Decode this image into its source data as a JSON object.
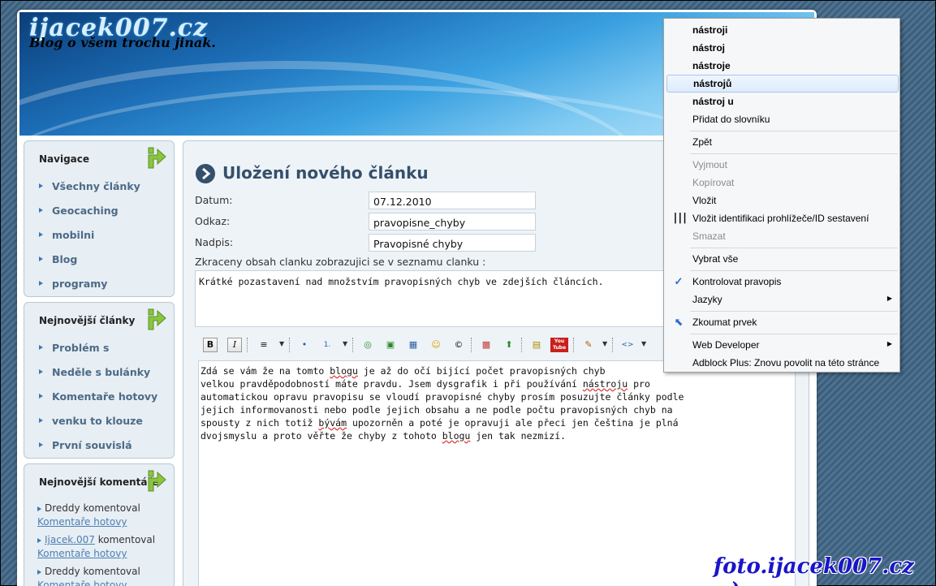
{
  "header": {
    "site_title": "ijacek007.cz",
    "subtitle": "Blog o všem trochu jinak."
  },
  "sidebar": {
    "navigation": {
      "title": "Navigace",
      "items": [
        "Všechny články",
        "Geocaching",
        "mobilni",
        "Blog",
        "programy"
      ]
    },
    "latest_articles": {
      "title": "Nejnovější články",
      "items": [
        "Problém s",
        "Neděle s bulánky",
        "Komentaře hotovy",
        "venku to klouze",
        "První souvislá"
      ]
    },
    "latest_comments": {
      "title": "Nejnovější komentáře",
      "items": [
        {
          "author": "Dreddy",
          "verb": "komentoval",
          "link": "Komentaře hotovy"
        },
        {
          "author": "Ijacek.007",
          "verb": "komentoval",
          "link": "Komentaře hotovy"
        },
        {
          "author": "Dreddy",
          "verb": "komentoval",
          "link": "Komentaře hotovy"
        }
      ]
    }
  },
  "content": {
    "title": "Uložení nového článku",
    "form": {
      "date_label": "Datum:",
      "date_value": "07.12.2010",
      "link_label": "Odkaz:",
      "link_value": "pravopisne_chyby",
      "heading_label": "Nadpis:",
      "heading_value": "Pravopisné chyby",
      "summary_label": "Zkraceny obsah clanku zobrazujici se v seznamu clanku :",
      "summary_value": "Krátké pozastavení nad množstvím pravopisných chyb ve zdejších článcích."
    },
    "editor": {
      "lines": [
        "Zdá se vám že na tomto ",
        "blogu",
        " je až do očí bijící počet pravopisných chyb",
        "velkou pravděpodobností máte pravdu. Jsem dysgrafik i při používání ",
        "nástroju",
        " pro",
        "automatickou opravu pravopisu se vloudí pravopisné chyby prosím posuzujte články podle",
        "jejich informovanosti nebo podle jejich obsahu a ne podle počtu pravopisných chyb na",
        "spousty z nich totiž ",
        "bývám",
        " upozorněn a poté je opravuji ale přeci jen čeština je plná",
        "dvojsmyslu a proto věřte že chyby z tohoto ",
        "blogu",
        " jen tak nezmizí."
      ]
    },
    "toolbar_buttons": [
      "B",
      "I",
      "≡",
      "•",
      "1.",
      "◎",
      "▣",
      "▦",
      "☺",
      "©",
      "▩",
      "⬆",
      "▤",
      "You Tube",
      "✎",
      "<>"
    ]
  },
  "context_menu": {
    "suggestions": [
      "nástroji",
      "nástroj",
      "nástroje",
      "nástrojů",
      "nástroj u"
    ],
    "add_to_dictionary": "Přidat do slovníku",
    "undo": "Zpět",
    "cut": "Vyjmout",
    "copy": "Kopírovat",
    "paste": "Vložit",
    "paste_ua": "Vložit identifikaci prohlížeče/ID sestavení",
    "delete": "Smazat",
    "select_all": "Vybrat vše",
    "spellcheck": "Kontrolovat pravopis",
    "languages": "Jazyky",
    "inspect": "Zkoumat prvek",
    "web_developer": "Web Developer",
    "adblock": "Adblock Plus: Znovu povolit na této stránce"
  },
  "watermark": "foto.ijacek007.cz :-)",
  "colors": {
    "accent": "#34506c",
    "link": "#4d7fb3",
    "nav_text": "#4d6a86",
    "menu_highlight": "#dcebfb",
    "watermark": "#1a15c8",
    "arrow_green": "#8bc53f"
  }
}
